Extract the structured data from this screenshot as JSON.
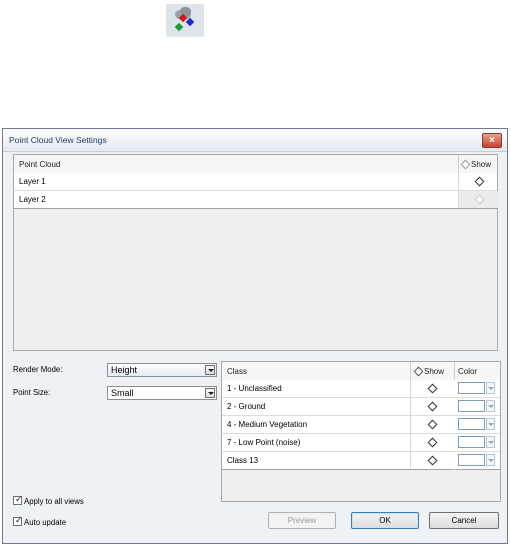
{
  "tool_icon": {
    "name": "point-cloud-icon",
    "colors": [
      "#d01818",
      "#1c28d0",
      "#16a030"
    ]
  },
  "dialog": {
    "title": "Point Cloud View Settings",
    "close_label": "×"
  },
  "point_cloud_table": {
    "headers": {
      "name": "Point Cloud",
      "show": "Show"
    },
    "rows": [
      {
        "name": "Layer 1",
        "show": true
      },
      {
        "name": "Layer 2",
        "show": false
      }
    ]
  },
  "render_mode": {
    "label": "Render Mode:",
    "value": "Height"
  },
  "point_size": {
    "label": "Point Size:",
    "value": "Small"
  },
  "class_table": {
    "headers": {
      "class": "Class",
      "show": "Show",
      "color": "Color"
    },
    "rows": [
      {
        "name": "1 - Unclassified"
      },
      {
        "name": "2 - Ground"
      },
      {
        "name": "4 - Medium Vegetation"
      },
      {
        "name": "7 - Low Point (noise)"
      },
      {
        "name": "Class 13"
      }
    ]
  },
  "options": {
    "apply_all_views": {
      "label": "Apply to all views",
      "checked": true
    },
    "auto_update": {
      "label": "Auto update",
      "checked": true
    }
  },
  "buttons": {
    "preview": "Preview",
    "ok": "OK",
    "cancel": "Cancel"
  }
}
